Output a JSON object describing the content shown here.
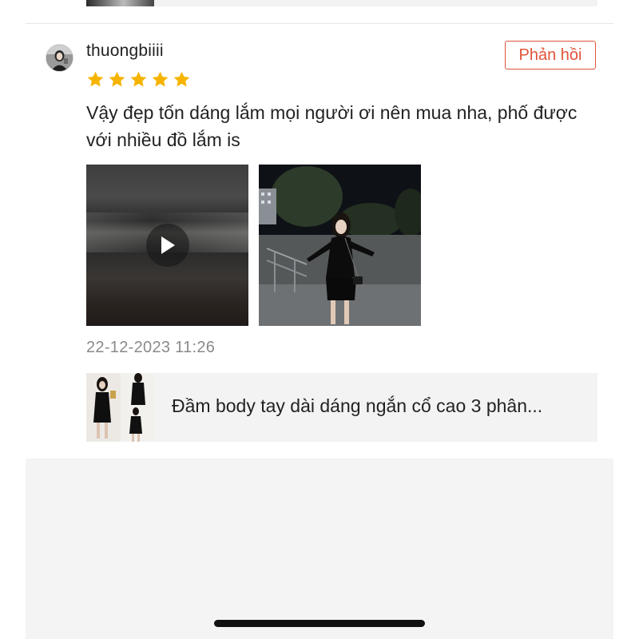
{
  "review": {
    "username": "thuongbiiii",
    "rating": 5,
    "text": "Vậy đẹp tốn dáng lắm mọi người ơi nên mua nha, phố được với nhiều đồ lắm is",
    "timestamp": "22-12-2023 11:26",
    "reply_label": "Phản hồi",
    "media": [
      {
        "type": "video",
        "icon": "play-icon"
      },
      {
        "type": "photo",
        "icon": "photo"
      }
    ]
  },
  "product": {
    "title": "Đầm body tay dài dáng ngắn cổ cao 3 phân..."
  },
  "colors": {
    "accent": "#e0533a",
    "star": "#f6b400",
    "timestamp": "#8a8a8a",
    "card_bg": "#f3f3f3"
  }
}
